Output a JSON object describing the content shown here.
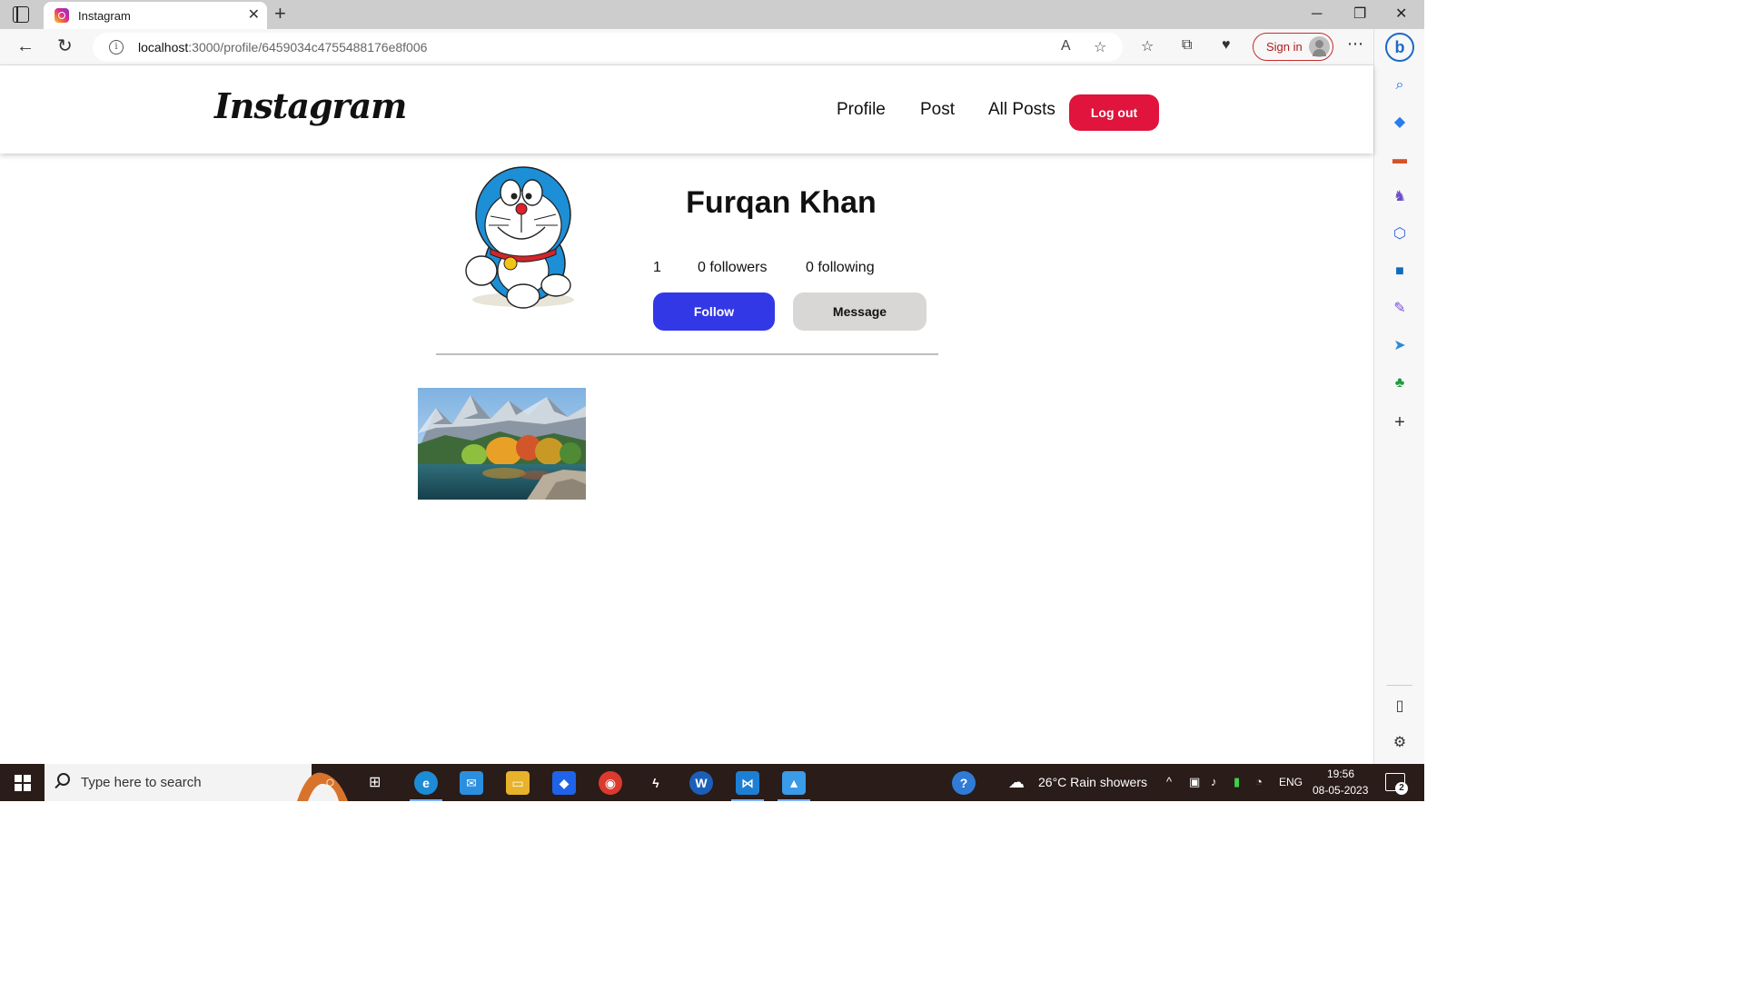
{
  "browser": {
    "tab": {
      "title": "Instagram"
    },
    "url": {
      "host": "localhost",
      "path": ":3000/profile/6459034c4755488176e8f006"
    },
    "signin_label": "Sign in"
  },
  "app": {
    "logo": "Instagram",
    "nav": [
      {
        "label": "Profile"
      },
      {
        "label": "Post"
      },
      {
        "label": "All Posts"
      }
    ],
    "logout_label": "Log out"
  },
  "profile": {
    "name": "Furqan Khan",
    "stats": {
      "posts": "1",
      "followers": "0 followers",
      "following": "0 following"
    },
    "follow_label": "Follow",
    "message_label": "Message"
  },
  "taskbar": {
    "search_placeholder": "Type here to search",
    "weather": "26°C  Rain showers",
    "language": "ENG",
    "time": "19:56",
    "date": "08-05-2023",
    "notification_count": "2"
  },
  "colors": {
    "logout": "#e0143c",
    "follow": "#3338e6",
    "message": "#d9d6d6",
    "taskbar": "#2a1c18"
  }
}
